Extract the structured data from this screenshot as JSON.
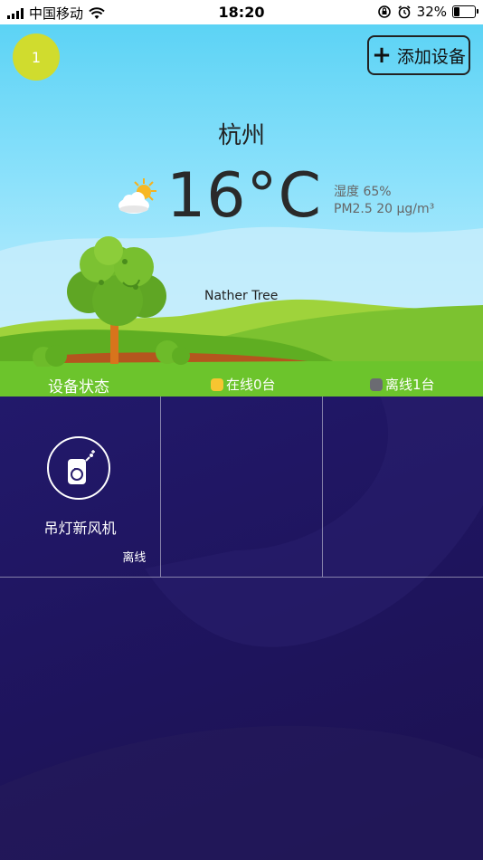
{
  "statusbar": {
    "carrier": "中国移动",
    "time": "18:20",
    "battery": "32%",
    "battery_level": 0.32,
    "icons": [
      "signal-icon",
      "wifi-icon",
      "rotation-lock-icon",
      "alarm-icon",
      "battery-icon"
    ]
  },
  "header": {
    "avatar_text": "1",
    "add_device_label": "添加设备"
  },
  "weather": {
    "city": "杭州",
    "temperature": "16°C",
    "humidity": "湿度 65%",
    "pm25": "PM2.5 20 μg/m³",
    "icon": "partly-cloudy-icon",
    "scene_label": "Nather Tree"
  },
  "device_status": {
    "title": "设备状态",
    "online": "在线0台",
    "offline": "离线1台",
    "online_color": "#f7c531",
    "offline_color": "#6b6b72"
  },
  "devices": [
    {
      "name": "吊灯新风机",
      "status": "离线",
      "icon": "fresh-air-unit-icon"
    }
  ],
  "colors": {
    "sky_top": "#5cd3f5",
    "grass": "#6cc42c",
    "panel_bg": "#1f1560",
    "avatar": "#d0dc2e"
  }
}
